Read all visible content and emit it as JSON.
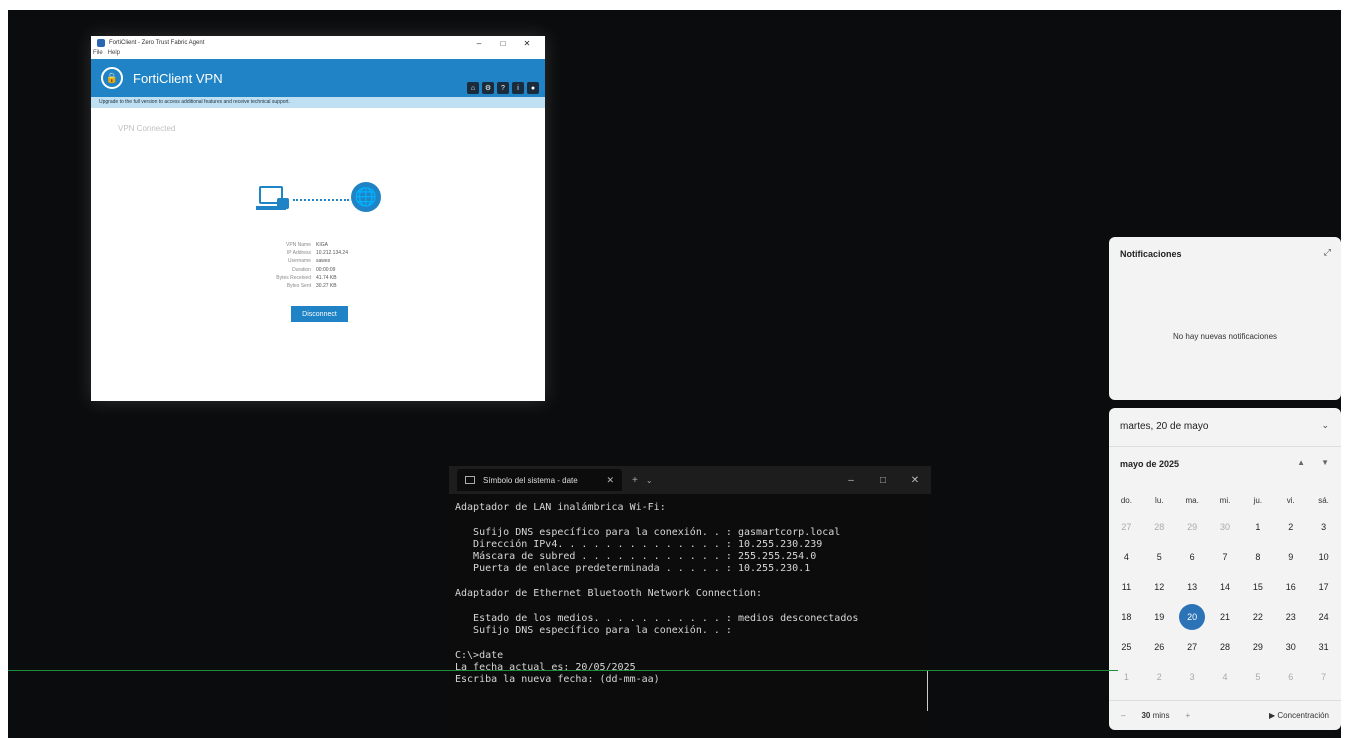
{
  "forticlient": {
    "window_title": "FortiClient - Zero Trust Fabric Agent",
    "menu": [
      "File",
      "Help"
    ],
    "app_name": "FortiClient VPN",
    "banner": "Upgrade to the full version to access additional features and receive technical support.",
    "status": "VPN Connected",
    "info": [
      {
        "label": "VPN Name",
        "value": "KIGA"
      },
      {
        "label": "IP Address",
        "value": "10.212.134.24"
      },
      {
        "label": "Username",
        "value": "sawes"
      },
      {
        "label": "Duration",
        "value": "00:00:09"
      },
      {
        "label": "Bytes Received",
        "value": "41.74 KB"
      },
      {
        "label": "Bytes Sent",
        "value": "30.27 KB"
      }
    ],
    "disconnect_label": "Disconnect"
  },
  "notifications": {
    "title": "Notificaciones",
    "message": "No hay nuevas notificaciones"
  },
  "calendar": {
    "date_header": "martes, 20 de mayo",
    "month_label": "mayo de 2025",
    "weekdays": [
      "do.",
      "lu.",
      "ma.",
      "mi.",
      "ju.",
      "vi.",
      "sá."
    ],
    "weeks": [
      [
        "27",
        "28",
        "29",
        "30",
        "1",
        "2",
        "3"
      ],
      [
        "4",
        "5",
        "6",
        "7",
        "8",
        "9",
        "10"
      ],
      [
        "11",
        "12",
        "13",
        "14",
        "15",
        "16",
        "17"
      ],
      [
        "18",
        "19",
        "20",
        "21",
        "22",
        "23",
        "24"
      ],
      [
        "25",
        "26",
        "27",
        "28",
        "29",
        "30",
        "31"
      ],
      [
        "1",
        "2",
        "3",
        "4",
        "5",
        "6",
        "7"
      ]
    ],
    "today": "20",
    "focus_minutes": "30",
    "focus_unit": "mins",
    "focus_label": "Concentración"
  },
  "terminal": {
    "tab_title": "Símbolo del sistema - date",
    "lines": [
      "Adaptador de LAN inalámbrica Wi-Fi:",
      "",
      "   Sufijo DNS específico para la conexión. . : gasmartcorp.local",
      "   Dirección IPv4. . . . . . . . . . . . . . : 10.255.230.239",
      "   Máscara de subred . . . . . . . . . . . . : 255.255.254.0",
      "   Puerta de enlace predeterminada . . . . . : 10.255.230.1",
      "",
      "Adaptador de Ethernet Bluetooth Network Connection:",
      "",
      "   Estado de los medios. . . . . . . . . . . : medios desconectados",
      "   Sufijo DNS específico para la conexión. . :",
      "",
      "C:\\>date",
      "La fecha actual es: 20/05/2025",
      "Escriba la nueva fecha: (dd-mm-aa)"
    ]
  }
}
